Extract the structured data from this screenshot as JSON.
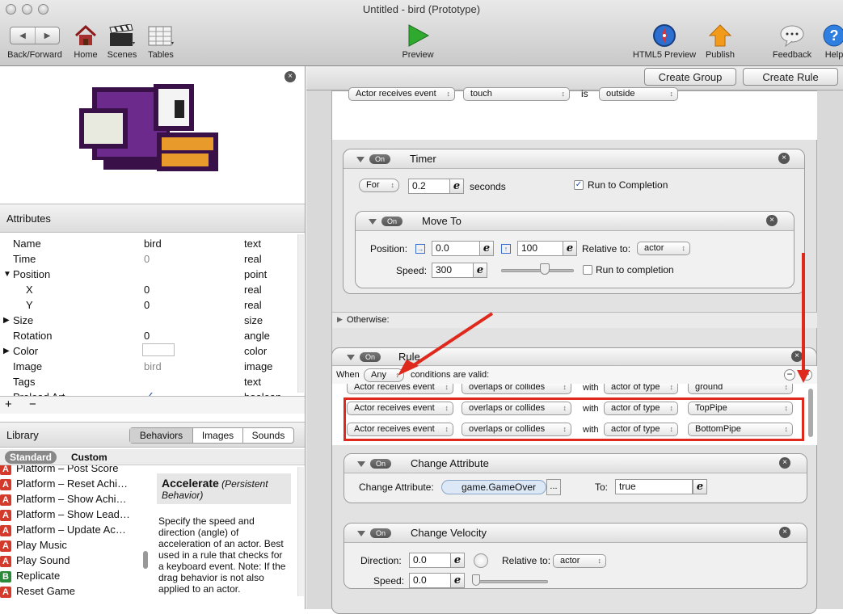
{
  "window": {
    "title": "Untitled - bird (Prototype)"
  },
  "toolbar": {
    "backforward": "Back/Forward",
    "home": "Home",
    "scenes": "Scenes",
    "tables": "Tables",
    "preview": "Preview",
    "html5": "HTML5 Preview",
    "publish": "Publish",
    "feedback": "Feedback",
    "help": "Help"
  },
  "buttons": {
    "create_group": "Create Group",
    "create_rule": "Create Rule"
  },
  "attributes": {
    "header": "Attributes",
    "rows": [
      {
        "name": "Name",
        "value": "bird",
        "type": "text"
      },
      {
        "name": "Time",
        "value": "0",
        "type": "real"
      },
      {
        "name": "Position",
        "value": "",
        "type": "point"
      },
      {
        "name": "X",
        "value": "0",
        "type": "real"
      },
      {
        "name": "Y",
        "value": "0",
        "type": "real"
      },
      {
        "name": "Size",
        "value": "",
        "type": "size"
      },
      {
        "name": "Rotation",
        "value": "0",
        "type": "angle"
      },
      {
        "name": "Color",
        "value": "",
        "type": "color"
      },
      {
        "name": "Image",
        "value": "bird",
        "type": "image"
      },
      {
        "name": "Tags",
        "value": "",
        "type": "text"
      },
      {
        "name": "Preload Art",
        "value": "",
        "type": "boolean"
      }
    ]
  },
  "library": {
    "header": "Library",
    "tabs": [
      "Behaviors",
      "Images",
      "Sounds"
    ],
    "subtabs": [
      "Standard",
      "Custom"
    ],
    "items": [
      "Platform – Post Score",
      "Platform – Reset Achi…",
      "Platform – Show Achi…",
      "Platform – Show Lead…",
      "Platform – Update Ac…",
      "Play Music",
      "Play Sound",
      "Replicate",
      "Reset Game"
    ],
    "desc_title": "Accelerate",
    "desc_sub": "(Persistent Behavior)",
    "desc_text": "Specify the speed and direction (angle) of acceleration of an actor. Best used in a rule that checks for a keyboard event. Note: If the drag behavior is not also applied to an actor."
  },
  "top_rule": {
    "event": "Actor receives event",
    "kind": "touch",
    "is": "is",
    "state": "outside"
  },
  "timer": {
    "on": "On",
    "title": "Timer",
    "mode": "For",
    "value": "0.2",
    "unit": "seconds",
    "run": "Run to Completion"
  },
  "moveto": {
    "on": "On",
    "title": "Move To",
    "position_label": "Position:",
    "x": "0.0",
    "y": "100",
    "relative_label": "Relative to:",
    "relative": "actor",
    "speed_label": "Speed:",
    "speed": "300",
    "run": "Run to completion"
  },
  "otherwise": "Otherwise:",
  "rule": {
    "on": "On",
    "title": "Rule",
    "when": "When",
    "any": "Any",
    "conditions_text": "conditions are valid:",
    "conditions": [
      {
        "event": "Actor receives event",
        "kind": "overlaps or collides",
        "with": "with",
        "type": "actor of type",
        "target": "ground"
      },
      {
        "event": "Actor receives event",
        "kind": "overlaps or collides",
        "with": "with",
        "type": "actor of type",
        "target": "TopPipe"
      },
      {
        "event": "Actor receives event",
        "kind": "overlaps or collides",
        "with": "with",
        "type": "actor of type",
        "target": "BottomPipe"
      }
    ]
  },
  "change_attr": {
    "on": "On",
    "title": "Change Attribute",
    "label": "Change Attribute:",
    "attr": "game.GameOver",
    "more": "...",
    "to_label": "To:",
    "to": "true"
  },
  "change_vel": {
    "on": "On",
    "title": "Change Velocity",
    "direction_label": "Direction:",
    "direction": "0.0",
    "relative_label": "Relative to:",
    "relative": "actor",
    "speed_label": "Speed:",
    "speed": "0.0"
  },
  "colors": {
    "accent": "#e0291d",
    "bird": "#6b2a8c",
    "beak": "#e89a2a"
  }
}
